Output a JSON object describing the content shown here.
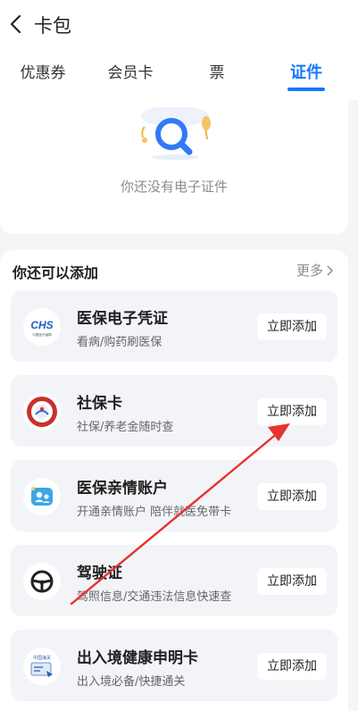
{
  "header": {
    "title": "卡包",
    "back_icon": "chevron-left-icon"
  },
  "tabs": [
    {
      "label": "优惠券",
      "active": false
    },
    {
      "label": "会员卡",
      "active": false
    },
    {
      "label": "票",
      "active": false
    },
    {
      "label": "证件",
      "active": true
    }
  ],
  "empty_state": {
    "message": "你还没有电子证件",
    "icon": "search-illustration-icon"
  },
  "add_section": {
    "title": "你还可以添加",
    "more_label": "更多",
    "items": [
      {
        "name": "医保电子凭证",
        "desc": "看病/购药刷医保",
        "button": "立即添加",
        "logo_text": "CHS",
        "logo_subtext": "中国医疗保障"
      },
      {
        "name": "社保卡",
        "desc": "社保/养老金随时查",
        "button": "立即添加"
      },
      {
        "name": "医保亲情账户",
        "desc": "开通亲情账户 陪伴就医免带卡",
        "button": "立即添加"
      },
      {
        "name": "驾驶证",
        "desc": "驾照信息/交通违法信息快速查",
        "button": "立即添加"
      },
      {
        "name": "出入境健康申明卡",
        "desc": "出入境必备/快捷通关",
        "button": "立即添加",
        "logo_text": "中国海关"
      }
    ]
  },
  "colors": {
    "accent": "#1677ff",
    "annotation_arrow": "#e8322f"
  }
}
